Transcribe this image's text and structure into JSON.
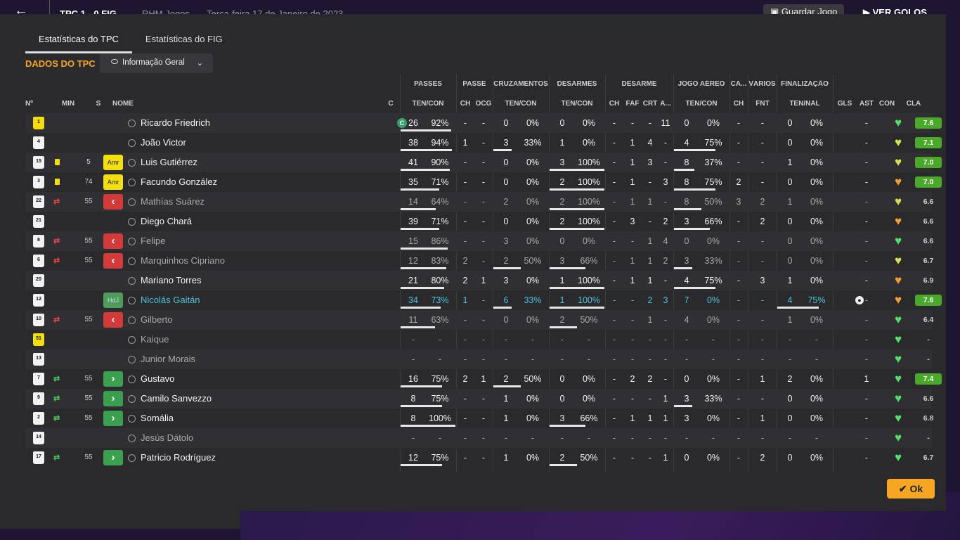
{
  "topbar": {
    "back_icon": "arrow-left-icon",
    "score": "TPC  1 - 0  FIG",
    "competition": "RHM Jogos",
    "date": "Terça-feira 17 de Janeiro de 2023",
    "save_label": "Guardar Jogo",
    "goals_label": "VER GOLOS"
  },
  "tabs": [
    "Estatísticas do TPC",
    "Estatísticas do FIG"
  ],
  "section_title": "DADOS DO TPC",
  "view_dropdown": {
    "selected": "Informação Geral"
  },
  "group_headers": {
    "passes": "PASSES",
    "passe": "PASSE",
    "cruzamentos": "CRUZAMENTOS",
    "desarmes": "DESARMES",
    "desarme": "DESARME",
    "jogo_aereo": "JOGO AÉREO",
    "ca": "CA...",
    "varios": "VÁRIOS",
    "finalizacao": "FINALIZAÇÃO"
  },
  "columns": {
    "num": "Nº",
    "min": "MIN",
    "s": "S",
    "nome": "NOME",
    "c": "C",
    "passes": "TEN/CON",
    "passe_ch": "CH",
    "passe_ocg": "OCG",
    "cruz": "TEN/CON",
    "des": "TEN/CON",
    "dsm_ch": "CH",
    "dsm_faf": "FAF",
    "dsm_crt": "CRT",
    "dsm_a": "A...",
    "aereo": "TEN/CON",
    "ca_ch": "CH",
    "var_fnt": "FNT",
    "fin": "TEN/NAL",
    "gls": "GLS",
    "ast": "AST",
    "con": "CON",
    "cla": "CLA"
  },
  "colors": {
    "accent": "#f6a623",
    "highlight_name": "#4fc3dc",
    "rating_good": "#4aa82a",
    "card_yellow": "#f3de10",
    "sub_out": "#d33a3a",
    "sub_in": "#3aa050"
  },
  "players": [
    {
      "num": "1",
      "shirt": "yellow",
      "min": "",
      "card": false,
      "sub": "",
      "status": "",
      "name": "Ricardo Friedrich",
      "dim": false,
      "highlight": false,
      "captain": "C",
      "passes": [
        "26",
        "92%"
      ],
      "passes_frac": 0.92,
      "passe_ch": "-",
      "passe_ocg": "-",
      "cruz": [
        "0",
        "0%"
      ],
      "cruz_frac": 0,
      "des": [
        "0",
        "0%"
      ],
      "des_frac": 0,
      "dsm": [
        "-",
        "-",
        "-",
        "11"
      ],
      "aereo": [
        "0",
        "0%"
      ],
      "aereo_frac": 0,
      "ca_ch": "-",
      "fnt": "-",
      "fin": [
        "0",
        "0%"
      ],
      "fin_frac": 0,
      "gls": "",
      "gls_icon": false,
      "ast": "-",
      "con": "green",
      "cla": "7.6",
      "cla_bg": true
    },
    {
      "num": "4",
      "shirt": "white",
      "min": "",
      "card": false,
      "sub": "",
      "status": "",
      "name": "João Victor",
      "dim": false,
      "highlight": false,
      "captain": "",
      "passes": [
        "38",
        "94%"
      ],
      "passes_frac": 0.94,
      "passe_ch": "1",
      "passe_ocg": "-",
      "cruz": [
        "3",
        "33%"
      ],
      "cruz_frac": 0.33,
      "des": [
        "1",
        "0%"
      ],
      "des_frac": 0,
      "dsm": [
        "-",
        "1",
        "4",
        "-"
      ],
      "aereo": [
        "4",
        "75%"
      ],
      "aereo_frac": 0.75,
      "ca_ch": "-",
      "fnt": "-",
      "fin": [
        "0",
        "0%"
      ],
      "fin_frac": 0,
      "gls": "",
      "gls_icon": false,
      "ast": "-",
      "con": "yellow",
      "cla": "7.1",
      "cla_bg": true
    },
    {
      "num": "15",
      "shirt": "white",
      "min": "5",
      "card": true,
      "sub": "",
      "status": "Amr",
      "name": "Luis Gutiérrez",
      "dim": false,
      "highlight": false,
      "captain": "",
      "passes": [
        "41",
        "90%"
      ],
      "passes_frac": 0.9,
      "passe_ch": "-",
      "passe_ocg": "-",
      "cruz": [
        "0",
        "0%"
      ],
      "cruz_frac": 0,
      "des": [
        "3",
        "100%"
      ],
      "des_frac": 1,
      "dsm": [
        "-",
        "1",
        "3",
        "-"
      ],
      "aereo": [
        "8",
        "37%"
      ],
      "aereo_frac": 0.37,
      "ca_ch": "-",
      "fnt": "-",
      "fin": [
        "1",
        "0%"
      ],
      "fin_frac": 0,
      "gls": "",
      "gls_icon": false,
      "ast": "-",
      "con": "yellow",
      "cla": "7.0",
      "cla_bg": true
    },
    {
      "num": "3",
      "shirt": "white",
      "min": "74",
      "card": true,
      "sub": "",
      "status": "Amr",
      "name": "Facundo González",
      "dim": false,
      "highlight": false,
      "captain": "",
      "passes": [
        "35",
        "71%"
      ],
      "passes_frac": 0.71,
      "passe_ch": "-",
      "passe_ocg": "-",
      "cruz": [
        "0",
        "0%"
      ],
      "cruz_frac": 0,
      "des": [
        "2",
        "100%"
      ],
      "des_frac": 1,
      "dsm": [
        "-",
        "1",
        "-",
        "3"
      ],
      "aereo": [
        "8",
        "75%"
      ],
      "aereo_frac": 0.75,
      "ca_ch": "2",
      "fnt": "-",
      "fin": [
        "0",
        "0%"
      ],
      "fin_frac": 0,
      "gls": "",
      "gls_icon": false,
      "ast": "-",
      "con": "orange",
      "cla": "7.0",
      "cla_bg": true
    },
    {
      "num": "22",
      "shirt": "white",
      "min": "55",
      "card": false,
      "sub": "out",
      "status": "out",
      "name": "Mathías Suárez",
      "dim": true,
      "highlight": false,
      "captain": "",
      "passes": [
        "14",
        "64%"
      ],
      "passes_frac": 0.64,
      "passe_ch": "-",
      "passe_ocg": "-",
      "cruz": [
        "2",
        "0%"
      ],
      "cruz_frac": 0,
      "des": [
        "2",
        "100%"
      ],
      "des_frac": 1,
      "dsm": [
        "-",
        "1",
        "1",
        "-"
      ],
      "aereo": [
        "8",
        "50%"
      ],
      "aereo_frac": 0.5,
      "ca_ch": "3",
      "fnt": "2",
      "fin": [
        "1",
        "0%"
      ],
      "fin_frac": 0,
      "gls": "",
      "gls_icon": false,
      "ast": "-",
      "con": "yellow",
      "cla": "6.6",
      "cla_bg": false
    },
    {
      "num": "21",
      "shirt": "white",
      "min": "",
      "card": false,
      "sub": "",
      "status": "",
      "name": "Diego Chará",
      "dim": false,
      "highlight": false,
      "captain": "",
      "passes": [
        "39",
        "71%"
      ],
      "passes_frac": 0.71,
      "passe_ch": "-",
      "passe_ocg": "-",
      "cruz": [
        "0",
        "0%"
      ],
      "cruz_frac": 0,
      "des": [
        "2",
        "100%"
      ],
      "des_frac": 1,
      "dsm": [
        "-",
        "3",
        "-",
        "2"
      ],
      "aereo": [
        "3",
        "66%"
      ],
      "aereo_frac": 0.66,
      "ca_ch": "-",
      "fnt": "2",
      "fin": [
        "0",
        "0%"
      ],
      "fin_frac": 0,
      "gls": "",
      "gls_icon": false,
      "ast": "-",
      "con": "orange",
      "cla": "6.6",
      "cla_bg": false
    },
    {
      "num": "8",
      "shirt": "white",
      "min": "55",
      "card": false,
      "sub": "out",
      "status": "out",
      "name": "Felipe",
      "dim": true,
      "highlight": false,
      "captain": "",
      "passes": [
        "15",
        "86%"
      ],
      "passes_frac": 0.86,
      "passe_ch": "-",
      "passe_ocg": "-",
      "cruz": [
        "3",
        "0%"
      ],
      "cruz_frac": 0,
      "des": [
        "0",
        "0%"
      ],
      "des_frac": 0,
      "dsm": [
        "-",
        "-",
        "1",
        "4"
      ],
      "aereo": [
        "0",
        "0%"
      ],
      "aereo_frac": 0,
      "ca_ch": "-",
      "fnt": "-",
      "fin": [
        "0",
        "0%"
      ],
      "fin_frac": 0,
      "gls": "",
      "gls_icon": false,
      "ast": "-",
      "con": "green",
      "cla": "6.6",
      "cla_bg": false
    },
    {
      "num": "6",
      "shirt": "white",
      "min": "55",
      "card": false,
      "sub": "out",
      "status": "out",
      "name": "Marquinhos Cipriano",
      "dim": true,
      "highlight": false,
      "captain": "",
      "passes": [
        "12",
        "83%"
      ],
      "passes_frac": 0.83,
      "passe_ch": "2",
      "passe_ocg": "-",
      "cruz": [
        "2",
        "50%"
      ],
      "cruz_frac": 0.5,
      "des": [
        "3",
        "66%"
      ],
      "des_frac": 0.66,
      "dsm": [
        "-",
        "1",
        "1",
        "2"
      ],
      "aereo": [
        "3",
        "33%"
      ],
      "aereo_frac": 0.33,
      "ca_ch": "-",
      "fnt": "-",
      "fin": [
        "0",
        "0%"
      ],
      "fin_frac": 0,
      "gls": "",
      "gls_icon": false,
      "ast": "-",
      "con": "yellow",
      "cla": "6.7",
      "cla_bg": false
    },
    {
      "num": "20",
      "shirt": "white",
      "min": "",
      "card": false,
      "sub": "",
      "status": "",
      "name": "Mariano Torres",
      "dim": false,
      "highlight": false,
      "captain": "",
      "passes": [
        "21",
        "80%"
      ],
      "passes_frac": 0.8,
      "passe_ch": "2",
      "passe_ocg": "1",
      "cruz": [
        "3",
        "0%"
      ],
      "cruz_frac": 0,
      "des": [
        "1",
        "100%"
      ],
      "des_frac": 1,
      "dsm": [
        "-",
        "1",
        "1",
        "-"
      ],
      "aereo": [
        "4",
        "75%"
      ],
      "aereo_frac": 0.75,
      "ca_ch": "-",
      "fnt": "3",
      "fin": [
        "1",
        "0%"
      ],
      "fin_frac": 0,
      "gls": "",
      "gls_icon": false,
      "ast": "-",
      "con": "orange",
      "cla": "6.9",
      "cla_bg": false
    },
    {
      "num": "12",
      "shirt": "white",
      "min": "",
      "card": false,
      "sub": "",
      "status": "HdJ",
      "name": "Nicolás Gaitán",
      "dim": false,
      "highlight": true,
      "captain": "",
      "passes": [
        "34",
        "73%"
      ],
      "passes_frac": 0.73,
      "passe_ch": "1",
      "passe_ocg": "-",
      "cruz": [
        "6",
        "33%"
      ],
      "cruz_frac": 0.33,
      "des": [
        "1",
        "100%"
      ],
      "des_frac": 1,
      "dsm": [
        "-",
        "-",
        "2",
        "3"
      ],
      "aereo": [
        "7",
        "0%"
      ],
      "aereo_frac": 0,
      "ca_ch": "-",
      "fnt": "-",
      "fin": [
        "4",
        "75%"
      ],
      "fin_frac": 0.75,
      "gls": "",
      "gls_icon": true,
      "ast": "-",
      "con": "orange",
      "cla": "7.6",
      "cla_bg": true
    },
    {
      "num": "10",
      "shirt": "white",
      "min": "55",
      "card": false,
      "sub": "out",
      "status": "out",
      "name": "Gilberto",
      "dim": true,
      "highlight": false,
      "captain": "",
      "passes": [
        "11",
        "63%"
      ],
      "passes_frac": 0.63,
      "passe_ch": "-",
      "passe_ocg": "-",
      "cruz": [
        "0",
        "0%"
      ],
      "cruz_frac": 0,
      "des": [
        "2",
        "50%"
      ],
      "des_frac": 0.5,
      "dsm": [
        "-",
        "-",
        "1",
        "-"
      ],
      "aereo": [
        "4",
        "0%"
      ],
      "aereo_frac": 0,
      "ca_ch": "-",
      "fnt": "-",
      "fin": [
        "1",
        "0%"
      ],
      "fin_frac": 0,
      "gls": "",
      "gls_icon": false,
      "ast": "-",
      "con": "green",
      "cla": "6.4",
      "cla_bg": false
    },
    {
      "num": "51",
      "shirt": "yellow",
      "min": "",
      "card": false,
      "sub": "",
      "status": "",
      "name": "Kaique",
      "dim": true,
      "highlight": false,
      "captain": "",
      "passes": [
        "-",
        "-"
      ],
      "passes_frac": 0,
      "passe_ch": "-",
      "passe_ocg": "-",
      "cruz": [
        "-",
        "-"
      ],
      "cruz_frac": 0,
      "des": [
        "-",
        "-"
      ],
      "des_frac": 0,
      "dsm": [
        "-",
        "-",
        "-",
        "-"
      ],
      "aereo": [
        "-",
        "-"
      ],
      "aereo_frac": 0,
      "ca_ch": "-",
      "fnt": "-",
      "fin": [
        "-",
        "-"
      ],
      "fin_frac": 0,
      "gls": "",
      "gls_icon": false,
      "ast": "-",
      "con": "green",
      "cla": "-",
      "cla_bg": false
    },
    {
      "num": "13",
      "shirt": "white",
      "min": "",
      "card": false,
      "sub": "",
      "status": "",
      "name": "Junior Morais",
      "dim": true,
      "highlight": false,
      "captain": "",
      "passes": [
        "-",
        "-"
      ],
      "passes_frac": 0,
      "passe_ch": "-",
      "passe_ocg": "-",
      "cruz": [
        "-",
        "-"
      ],
      "cruz_frac": 0,
      "des": [
        "-",
        "-"
      ],
      "des_frac": 0,
      "dsm": [
        "-",
        "-",
        "-",
        "-"
      ],
      "aereo": [
        "-",
        "-"
      ],
      "aereo_frac": 0,
      "ca_ch": "-",
      "fnt": "-",
      "fin": [
        "-",
        "-"
      ],
      "fin_frac": 0,
      "gls": "",
      "gls_icon": false,
      "ast": "-",
      "con": "green",
      "cla": "-",
      "cla_bg": false
    },
    {
      "num": "7",
      "shirt": "white",
      "min": "55",
      "card": false,
      "sub": "in",
      "status": "in",
      "name": "Gustavo",
      "dim": false,
      "highlight": false,
      "captain": "",
      "passes": [
        "16",
        "75%"
      ],
      "passes_frac": 0.75,
      "passe_ch": "2",
      "passe_ocg": "1",
      "cruz": [
        "2",
        "50%"
      ],
      "cruz_frac": 0.5,
      "des": [
        "0",
        "0%"
      ],
      "des_frac": 0,
      "dsm": [
        "-",
        "2",
        "2",
        "-"
      ],
      "aereo": [
        "0",
        "0%"
      ],
      "aereo_frac": 0,
      "ca_ch": "-",
      "fnt": "1",
      "fin": [
        "2",
        "0%"
      ],
      "fin_frac": 0,
      "gls": "",
      "gls_icon": false,
      "ast": "1",
      "con": "green",
      "cla": "7.4",
      "cla_bg": true
    },
    {
      "num": "9",
      "shirt": "white",
      "min": "55",
      "card": false,
      "sub": "in",
      "status": "in",
      "name": "Camilo Sanvezzo",
      "dim": false,
      "highlight": false,
      "captain": "",
      "passes": [
        "8",
        "75%"
      ],
      "passes_frac": 0.75,
      "passe_ch": "-",
      "passe_ocg": "-",
      "cruz": [
        "1",
        "0%"
      ],
      "cruz_frac": 0,
      "des": [
        "0",
        "0%"
      ],
      "des_frac": 0,
      "dsm": [
        "-",
        "-",
        "-",
        "1"
      ],
      "aereo": [
        "3",
        "33%"
      ],
      "aereo_frac": 0.33,
      "ca_ch": "-",
      "fnt": "-",
      "fin": [
        "0",
        "0%"
      ],
      "fin_frac": 0,
      "gls": "",
      "gls_icon": false,
      "ast": "-",
      "con": "green",
      "cla": "6.6",
      "cla_bg": false
    },
    {
      "num": "2",
      "shirt": "white",
      "min": "55",
      "card": false,
      "sub": "in",
      "status": "in",
      "name": "Somália",
      "dim": false,
      "highlight": false,
      "captain": "",
      "passes": [
        "8",
        "100%"
      ],
      "passes_frac": 1,
      "passe_ch": "-",
      "passe_ocg": "-",
      "cruz": [
        "1",
        "0%"
      ],
      "cruz_frac": 0,
      "des": [
        "3",
        "66%"
      ],
      "des_frac": 0.66,
      "dsm": [
        "-",
        "1",
        "1",
        "1"
      ],
      "aereo": [
        "3",
        "0%"
      ],
      "aereo_frac": 0,
      "ca_ch": "-",
      "fnt": "1",
      "fin": [
        "0",
        "0%"
      ],
      "fin_frac": 0,
      "gls": "",
      "gls_icon": false,
      "ast": "-",
      "con": "green",
      "cla": "6.8",
      "cla_bg": false
    },
    {
      "num": "14",
      "shirt": "white",
      "min": "",
      "card": false,
      "sub": "",
      "status": "",
      "name": "Jesús Dátolo",
      "dim": true,
      "highlight": false,
      "captain": "",
      "passes": [
        "-",
        "-"
      ],
      "passes_frac": 0,
      "passe_ch": "-",
      "passe_ocg": "-",
      "cruz": [
        "-",
        "-"
      ],
      "cruz_frac": 0,
      "des": [
        "-",
        "-"
      ],
      "des_frac": 0,
      "dsm": [
        "-",
        "-",
        "-",
        "-"
      ],
      "aereo": [
        "-",
        "-"
      ],
      "aereo_frac": 0,
      "ca_ch": "-",
      "fnt": "-",
      "fin": [
        "-",
        "-"
      ],
      "fin_frac": 0,
      "gls": "",
      "gls_icon": false,
      "ast": "-",
      "con": "green",
      "cla": "-",
      "cla_bg": false
    },
    {
      "num": "17",
      "shirt": "white",
      "min": "55",
      "card": false,
      "sub": "in",
      "status": "in",
      "name": "Patricio Rodríguez",
      "dim": false,
      "highlight": false,
      "captain": "",
      "passes": [
        "12",
        "75%"
      ],
      "passes_frac": 0.75,
      "passe_ch": "-",
      "passe_ocg": "-",
      "cruz": [
        "1",
        "0%"
      ],
      "cruz_frac": 0,
      "des": [
        "2",
        "50%"
      ],
      "des_frac": 0.5,
      "dsm": [
        "-",
        "-",
        "-",
        "1"
      ],
      "aereo": [
        "0",
        "0%"
      ],
      "aereo_frac": 0,
      "ca_ch": "-",
      "fnt": "2",
      "fin": [
        "0",
        "0%"
      ],
      "fin_frac": 0,
      "gls": "",
      "gls_icon": false,
      "ast": "-",
      "con": "green",
      "cla": "6.7",
      "cla_bg": false
    }
  ],
  "ok_label": "Ok"
}
